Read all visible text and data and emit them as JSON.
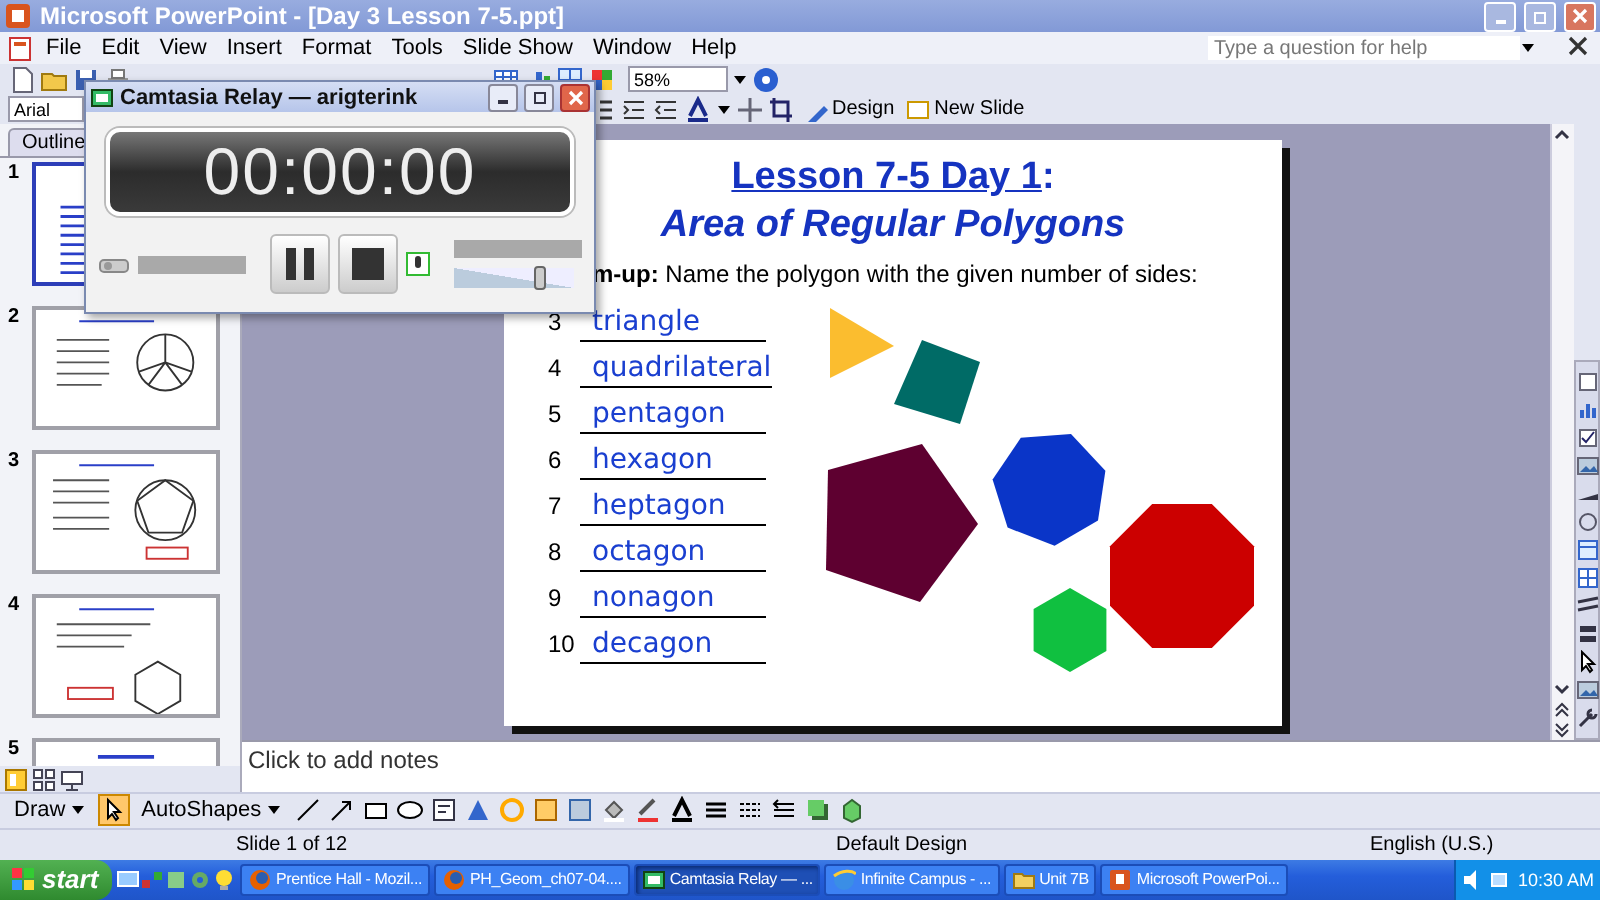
{
  "window": {
    "title": "Microsoft PowerPoint - [Day 3 Lesson 7-5.ppt]"
  },
  "menu": [
    "File",
    "Edit",
    "View",
    "Insert",
    "Format",
    "Tools",
    "Slide Show",
    "Window",
    "Help"
  ],
  "help_box": {
    "placeholder": "Type a question for help"
  },
  "standard_toolbar": {
    "zoom": "58%"
  },
  "formatting_toolbar": {
    "font": "Arial",
    "buttons": [
      "Design",
      "New Slide"
    ]
  },
  "side_panel": {
    "tabs": [
      {
        "label": "Outline",
        "selected": false
      }
    ],
    "thumbnails": [
      {
        "number": "1",
        "selected": true
      },
      {
        "number": "2",
        "selected": false
      },
      {
        "number": "3",
        "selected": false
      },
      {
        "number": "4",
        "selected": false
      },
      {
        "number": "5",
        "selected": false
      }
    ]
  },
  "slide": {
    "title": "Lesson 7-5 Day 1",
    "title_suffix": ":",
    "subtitle": "Area of Regular Polygons",
    "prompt": "**m-up:** Name the polygon with the given number of sides:",
    "answers": [
      {
        "number": "3",
        "answer": "triangle"
      },
      {
        "number": "4",
        "answer": "quadrilateral"
      },
      {
        "number": "5",
        "answer": "pentagon"
      },
      {
        "number": "6",
        "answer": "hexagon"
      },
      {
        "number": "7",
        "answer": "heptagon"
      },
      {
        "number": "8",
        "answer": "octagon"
      },
      {
        "number": "9",
        "answer": "nonagon"
      },
      {
        "number": "10",
        "answer": "decagon"
      }
    ]
  },
  "notes": {
    "placeholder": "Click to add notes"
  },
  "drawing_toolbar": {
    "menus": [
      "Draw",
      "AutoShapes"
    ]
  },
  "status_bar": [
    "Slide 1 of 12",
    "Default Design",
    "English (U.S.)"
  ],
  "recorder": {
    "title": "Camtasia Relay — arigterink",
    "timer": "00:00:00",
    "mic": {
      "level": 0.72
    }
  },
  "taskbar": {
    "start": "start",
    "tasks": [
      {
        "label": "Prentice Hall - Mozil...",
        "kind": "firefox",
        "selected": false
      },
      {
        "label": "PH_Geom_ch07-04....",
        "kind": "firefox",
        "selected": false
      },
      {
        "label": "Camtasia Relay — ...",
        "kind": "recorder",
        "selected": true
      },
      {
        "label": "Infinite Campus - ...",
        "kind": "ie",
        "selected": false
      },
      {
        "label": "Unit 7B",
        "kind": "folder",
        "selected": false
      },
      {
        "label": "Microsoft PowerPoi...",
        "kind": "powerpoint",
        "selected": false
      }
    ],
    "clock": "10:30 AM"
  }
}
